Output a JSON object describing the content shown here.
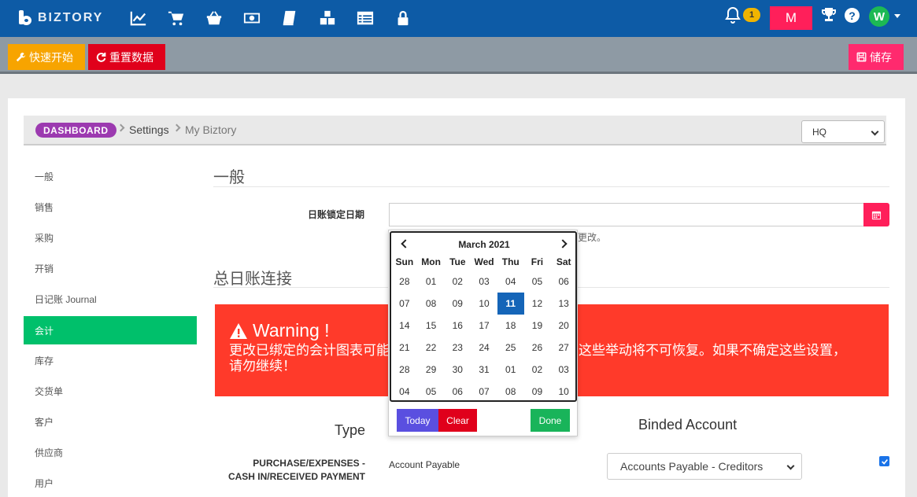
{
  "app": {
    "brand": "BIZTORY"
  },
  "topnav": {
    "icons": [
      "chart-line-icon",
      "cart-icon",
      "basket-icon",
      "money-icon",
      "book-icon",
      "cubes-icon",
      "list-icon",
      "lock-icon"
    ],
    "notification_count": "1",
    "user_initial": "M",
    "avatar_initial": "W",
    "help": "?"
  },
  "toolbar": {
    "quick_start": "快速开始",
    "reset_data": "重置数据",
    "save": "储存"
  },
  "breadcrumb": {
    "dashboard": "DASHBOARD",
    "settings": "Settings",
    "current": "My Biztory"
  },
  "branch": {
    "selected": "HQ"
  },
  "sidebar": {
    "items": [
      {
        "label": "一般"
      },
      {
        "label": "销售"
      },
      {
        "label": "采购"
      },
      {
        "label": "开销"
      },
      {
        "label": "日记账 Journal"
      },
      {
        "label": "会计"
      },
      {
        "label": "库存"
      },
      {
        "label": "交货单"
      },
      {
        "label": "客户"
      },
      {
        "label": "供应商"
      },
      {
        "label": "用户"
      }
    ],
    "active_index": 5
  },
  "general": {
    "title": "一般",
    "lock_date_label": "日账锁定日期",
    "lock_date_value": "",
    "hint_fragment": "更改。"
  },
  "ledger": {
    "title": "总日账连接"
  },
  "warning": {
    "title": "Warning !",
    "line1_left": "更改已绑定的会计图表可能",
    "line1_right": "这些举动将不可恢复。如果不确定这些设置，",
    "line2": "请勿继续！"
  },
  "table": {
    "col_type": "Type",
    "col_binded": "Binded Account",
    "rows": [
      {
        "label": "PURCHASE/EXPENSES - CASH IN/RECEIVED PAYMENT",
        "type": "Account Payable",
        "account": "Accounts Payable - Creditors",
        "checked": true
      }
    ]
  },
  "datepicker": {
    "month": "March 2021",
    "dow": [
      "Sun",
      "Mon",
      "Tue",
      "Wed",
      "Thu",
      "Fri",
      "Sat"
    ],
    "weeks": [
      [
        "28",
        "01",
        "02",
        "03",
        "04",
        "05",
        "06"
      ],
      [
        "07",
        "08",
        "09",
        "10",
        "11",
        "12",
        "13"
      ],
      [
        "14",
        "15",
        "16",
        "17",
        "18",
        "19",
        "20"
      ],
      [
        "21",
        "22",
        "23",
        "24",
        "25",
        "26",
        "27"
      ],
      [
        "28",
        "29",
        "30",
        "31",
        "01",
        "02",
        "03"
      ],
      [
        "04",
        "05",
        "06",
        "07",
        "08",
        "09",
        "10"
      ]
    ],
    "selected": "11",
    "today": "Today",
    "clear": "Clear",
    "done": "Done"
  },
  "colors": {
    "nav": "#0d5ba6",
    "accent_pink": "#ff1f5a",
    "active_green": "#00c06b",
    "warning_red": "#ff3a2a"
  }
}
